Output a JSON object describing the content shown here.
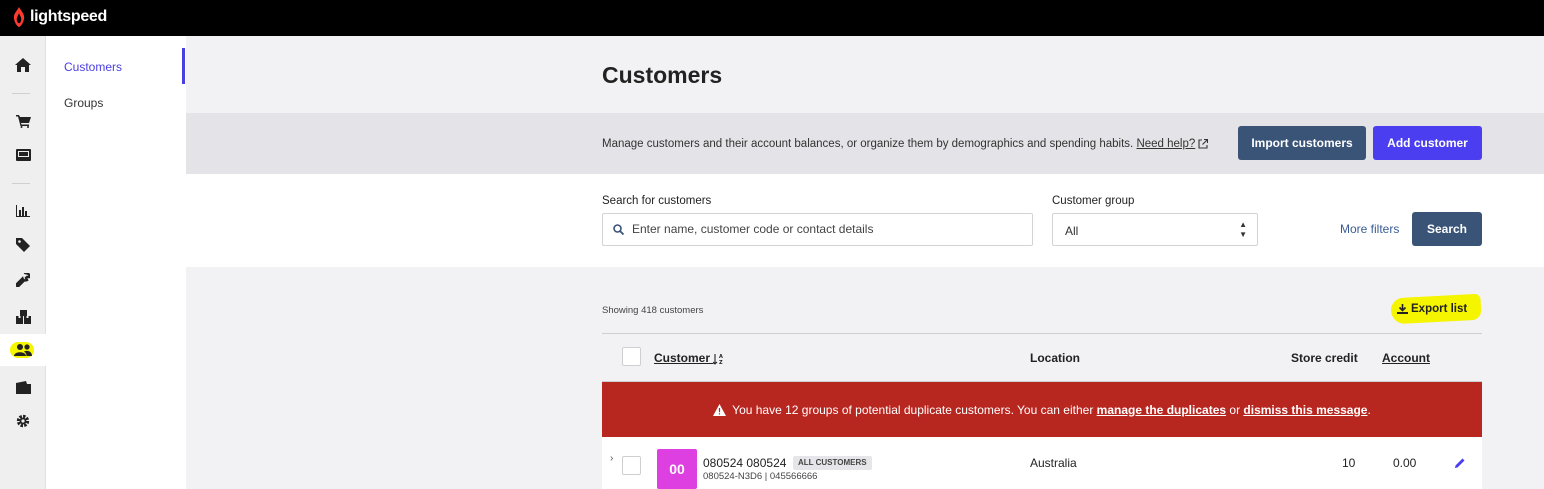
{
  "brand": {
    "name": "lightspeed",
    "color": "#ff3b30"
  },
  "rail": {
    "items": [
      {
        "name": "home-icon"
      },
      {
        "name": "cart-icon"
      },
      {
        "name": "register-icon"
      },
      {
        "name": "reports-icon"
      },
      {
        "name": "tag-icon"
      },
      {
        "name": "wrench-icon"
      },
      {
        "name": "inventory-icon"
      },
      {
        "name": "customers-icon",
        "active": true
      },
      {
        "name": "folder-icon"
      },
      {
        "name": "settings-icon"
      }
    ]
  },
  "subnav": {
    "items": [
      {
        "label": "Customers",
        "active": true
      },
      {
        "label": "Groups",
        "active": false
      }
    ]
  },
  "page": {
    "title": "Customers",
    "description": "Manage customers and their account balances, or organize them by demographics and spending habits.",
    "help_link": "Need help?",
    "import_button": "Import customers",
    "add_button": "Add customer"
  },
  "search": {
    "label": "Search for customers",
    "placeholder": "Enter name, customer code or contact details",
    "group_label": "Customer group",
    "group_value": "All",
    "more_filters": "More filters",
    "search_button": "Search"
  },
  "list": {
    "showing": "Showing 418 customers",
    "export": "Export list",
    "columns": {
      "customer": "Customer",
      "location": "Location",
      "store_credit": "Store credit",
      "account": "Account"
    },
    "alert": {
      "text_before": "You have 12 groups of potential duplicate customers. You can either",
      "link1": "manage the duplicates",
      "text_mid": "or",
      "link2": "dismiss this message",
      "text_end": "."
    },
    "rows": [
      {
        "initials": "00",
        "name": "080524 080524",
        "badge": "ALL CUSTOMERS",
        "sub": "080524-N3D6 | 045566666",
        "location": "Australia",
        "store_credit": "10",
        "account": "0.00"
      }
    ]
  },
  "colors": {
    "primary": "#4b3ef0",
    "secondary_button": "#3a5478",
    "alert": "#b82620",
    "avatar": "#dd3fe0",
    "highlight": "#f5f500"
  }
}
